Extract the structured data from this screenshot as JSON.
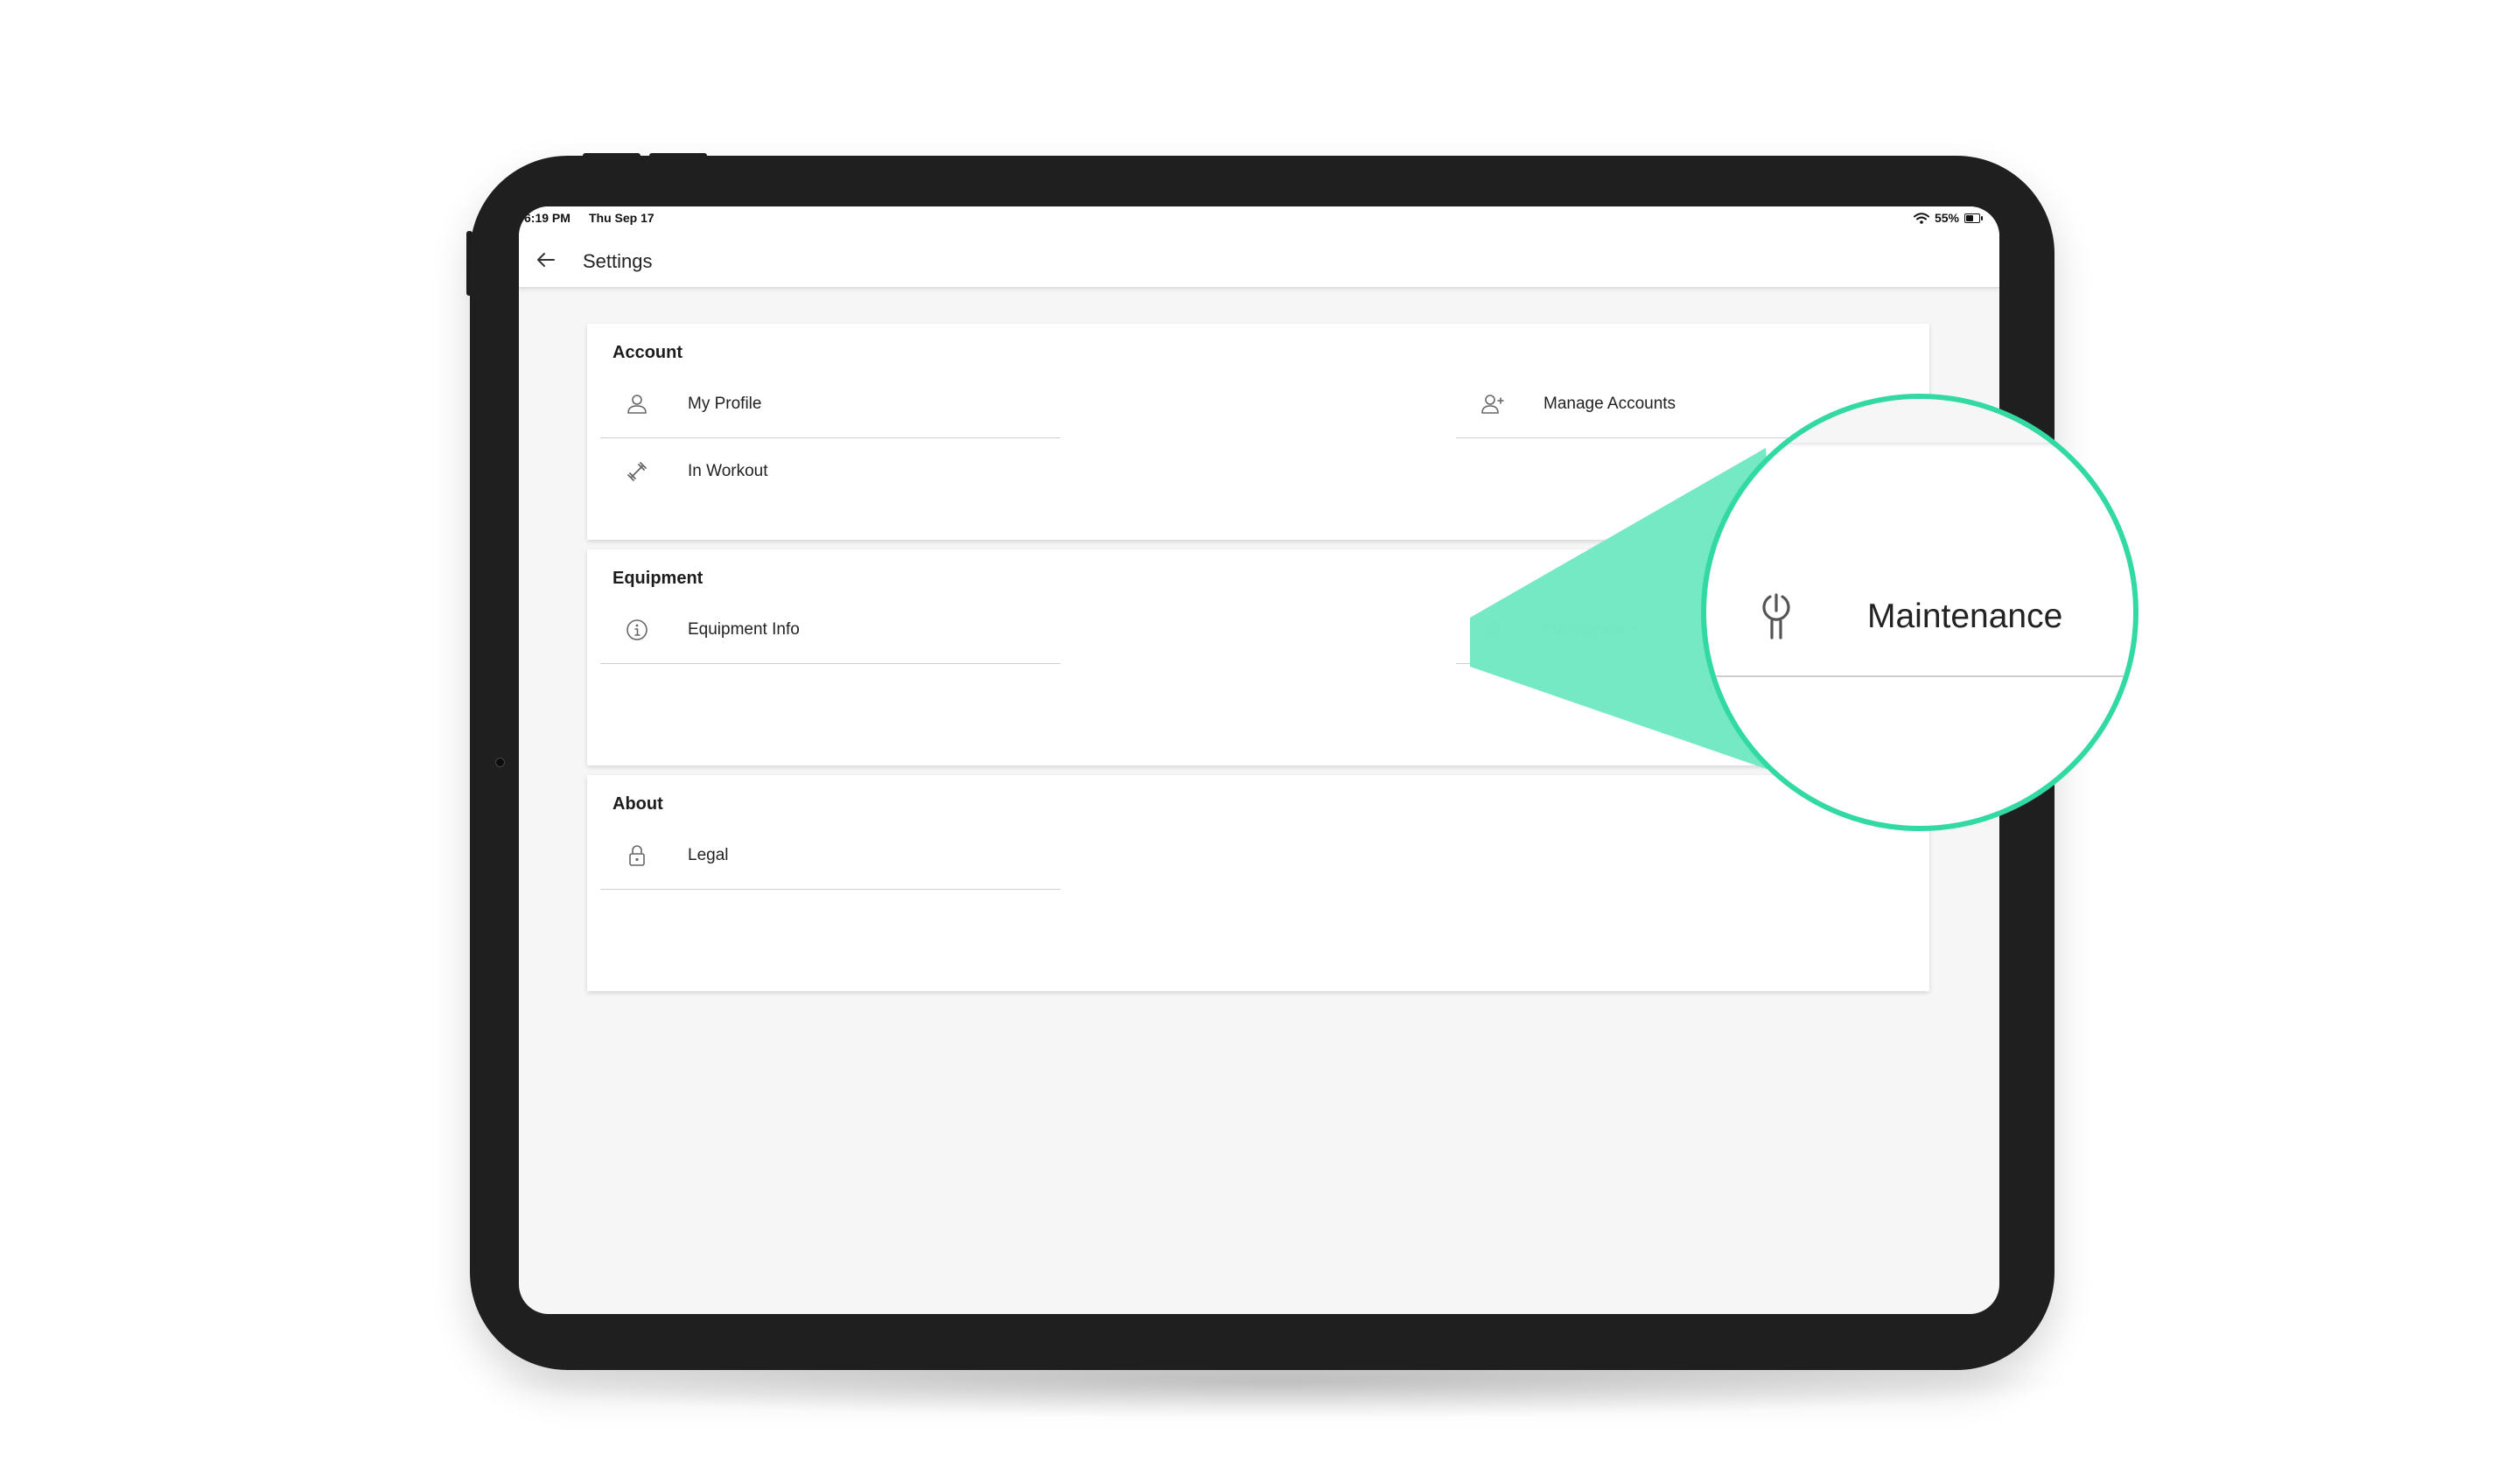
{
  "status_bar": {
    "time": "6:19 PM",
    "date": "Thu Sep 17",
    "battery": "55%",
    "battery_level": 0.55
  },
  "nav": {
    "title": "Settings",
    "back_icon": "arrow-left-icon"
  },
  "sections": {
    "account": {
      "title": "Account",
      "items": [
        {
          "label": "My Profile",
          "icon": "user-icon"
        },
        {
          "label": "Manage Accounts",
          "icon": "user-plus-icon"
        },
        {
          "label": "In Workout",
          "icon": "dumbbell-icon"
        }
      ]
    },
    "equipment": {
      "title": "Equipment",
      "items": [
        {
          "label": "Equipment Info",
          "icon": "info-icon"
        },
        {
          "label": "Maintenance",
          "icon": "wrench-icon"
        }
      ]
    },
    "about": {
      "title": "About",
      "items": [
        {
          "label": "Legal",
          "icon": "lock-icon"
        }
      ]
    }
  },
  "magnifier": {
    "label": "Maintenance",
    "icon": "wrench-icon"
  },
  "colors": {
    "accent": "#33d9a3",
    "accent_text": "#2bc492",
    "beam": "#72e8c3",
    "device": "#1f1f1f",
    "screen_bg": "#f6f6f6"
  }
}
